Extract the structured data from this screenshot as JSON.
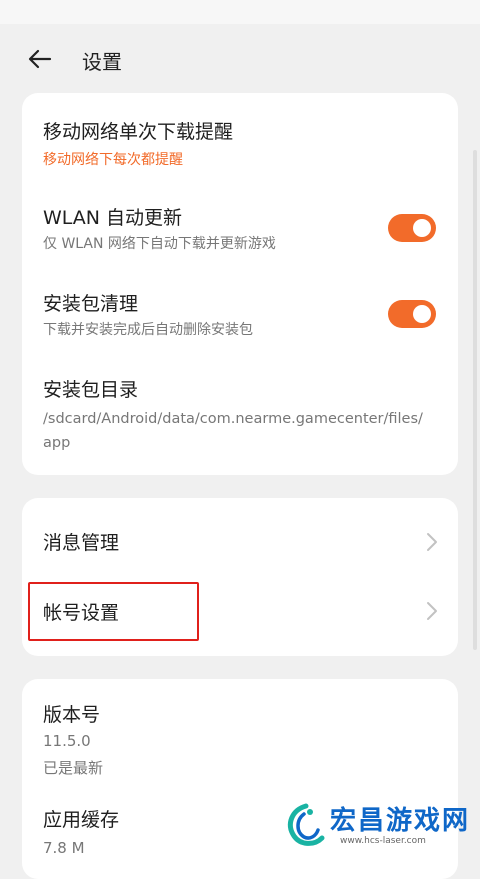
{
  "header": {
    "title": "设置"
  },
  "card1": {
    "items": [
      {
        "title": "移动网络单次下载提醒",
        "subtitle": "移动网络下每次都提醒"
      },
      {
        "title": "WLAN 自动更新",
        "subtitle": "仅 WLAN 网络下自动下载并更新游戏",
        "toggle_on": true
      },
      {
        "title": "安装包清理",
        "subtitle": "下载并安装完成后自动删除安装包",
        "toggle_on": true
      },
      {
        "title": "安装包目录",
        "subtitle_line1": "/sdcard/Android/data/com.nearme.gamecenter/files/",
        "subtitle_line2": "app"
      }
    ]
  },
  "card2": {
    "items": [
      {
        "title": "消息管理"
      },
      {
        "title": "帐号设置"
      }
    ]
  },
  "card3": {
    "items": [
      {
        "title": "版本号",
        "value": "11.5.0",
        "status": "已是最新"
      },
      {
        "title": "应用缓存",
        "value": "7.8 M"
      }
    ]
  },
  "watermark": {
    "text": "宏昌游戏网",
    "url": "www.hcs-laser.com"
  },
  "colors": {
    "accent": "#f26b2a",
    "highlight": "#e0201b",
    "brand": "#0f67c8"
  },
  "icons": {
    "back": "arrow-left-icon",
    "chevron": "chevron-right-icon"
  }
}
